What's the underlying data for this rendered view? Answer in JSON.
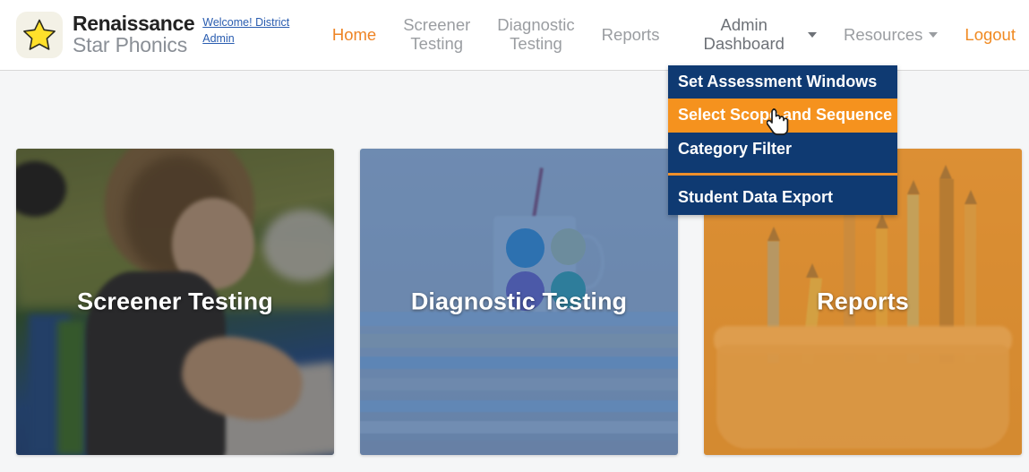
{
  "brand": {
    "line1": "Renaissance",
    "line2": "Star Phonics",
    "star_icon": "star-icon"
  },
  "welcome": {
    "text": "Welcome! District Admin"
  },
  "nav": {
    "items": [
      {
        "label": "Home",
        "state": "active",
        "has_caret": false
      },
      {
        "label": "Screener\nTesting",
        "state": "normal",
        "has_caret": false
      },
      {
        "label": "Diagnostic\nTesting",
        "state": "normal",
        "has_caret": false
      },
      {
        "label": "Reports",
        "state": "normal",
        "has_caret": false
      },
      {
        "label": "Admin Dashboard",
        "state": "open",
        "has_caret": true
      },
      {
        "label": "Resources",
        "state": "normal",
        "has_caret": true
      },
      {
        "label": "Logout",
        "state": "logout",
        "has_caret": false
      }
    ]
  },
  "dropdown": {
    "open_for": "Admin Dashboard",
    "items": [
      {
        "label": "Set Assessment Windows",
        "highlighted": false
      },
      {
        "label": "Select Scope and Sequence",
        "highlighted": true
      },
      {
        "label": "Category Filter",
        "highlighted": false
      }
    ],
    "footer_items": [
      {
        "label": "Student Data Export",
        "highlighted": false
      }
    ],
    "background_color": "#0f3a72",
    "highlight_color": "#f5921e",
    "divider_color": "#ef8f2a",
    "cursor": "pointing-hand-cursor"
  },
  "cards": [
    {
      "title": "Screener Testing",
      "art": "child-writing-photo",
      "tint": "#121418"
    },
    {
      "title": "Diagnostic Testing",
      "art": "stacked-books-and-mug-photo",
      "tint": "#245496"
    },
    {
      "title": "Reports",
      "art": "colored-pencils-in-basket-photo",
      "tint": "#e08c26"
    }
  ],
  "colors": {
    "accent_orange": "#ee8425",
    "navy": "#0f3a72",
    "page_background": "#f5f6f7",
    "header_background": "#ffffff",
    "nav_text": "#9a9da1",
    "link_blue": "#2a5db0"
  }
}
